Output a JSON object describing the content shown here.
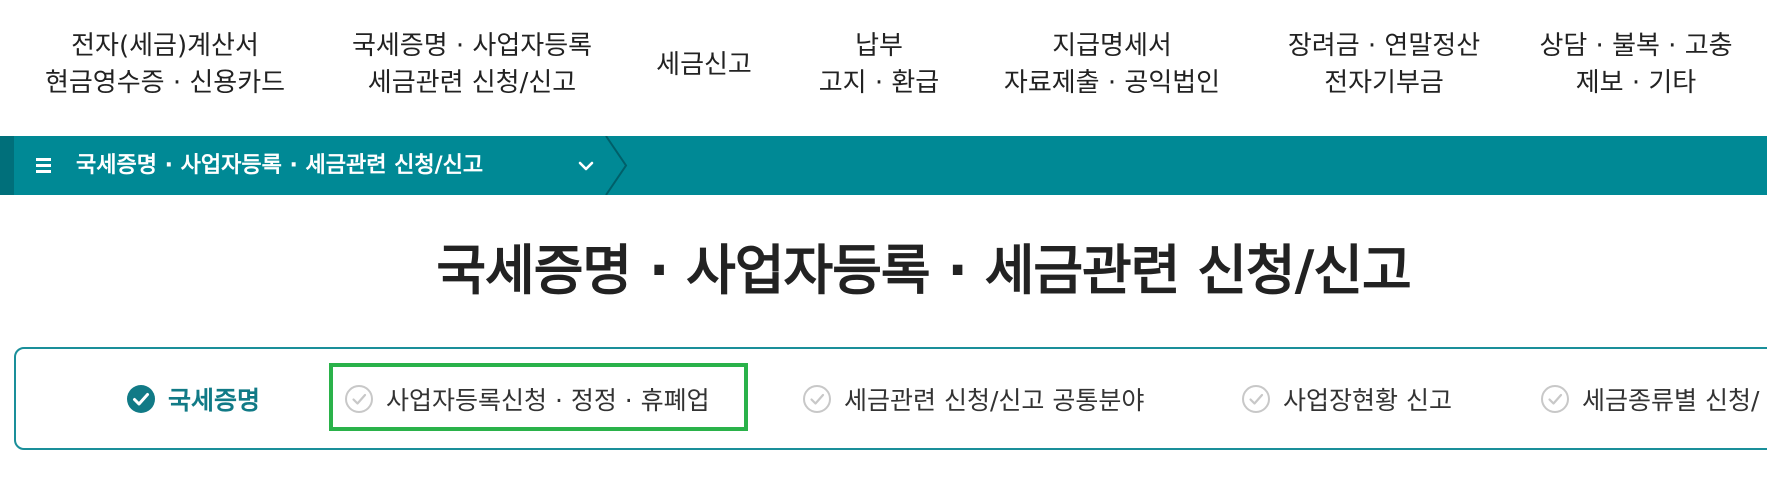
{
  "top_nav": {
    "items": [
      {
        "line1": "전자(세금)계산서",
        "line2": "현금영수증 · 신용카드"
      },
      {
        "line1": "국세증명 · 사업자등록",
        "line2": "세금관련 신청/신고"
      },
      {
        "line1": "세금신고",
        "line2": ""
      },
      {
        "line1": "납부",
        "line2": "고지 · 환급"
      },
      {
        "line1": "지급명세서",
        "line2": "자료제출 · 공익법인"
      },
      {
        "line1": "장려금 · 연말정산",
        "line2": "전자기부금"
      },
      {
        "line1": "상담 · 불복 · 고충",
        "line2": "제보 · 기타"
      }
    ]
  },
  "breadcrumb": {
    "label": "국세증명 · 사업자등록 · 세금관련 신청/신고",
    "menu_icon": "hamburger-menu-icon",
    "expand_icon": "chevron-down-icon"
  },
  "page": {
    "title": "국세증명 · 사업자등록 · 세금관련 신청/신고"
  },
  "tabs": [
    {
      "label": "국세증명",
      "active": true
    },
    {
      "label": "사업자등록신청 · 정정 · 휴폐업",
      "active": false,
      "highlighted": true
    },
    {
      "label": "세금관련 신청/신고 공통분야",
      "active": false
    },
    {
      "label": "사업장현황 신고",
      "active": false
    },
    {
      "label": "세금종류별 신청/",
      "active": false
    }
  ],
  "colors": {
    "bar": "#008995",
    "accent": "#117a86",
    "highlight": "#2ab24a",
    "inactive_check": "#c8c8c8"
  }
}
